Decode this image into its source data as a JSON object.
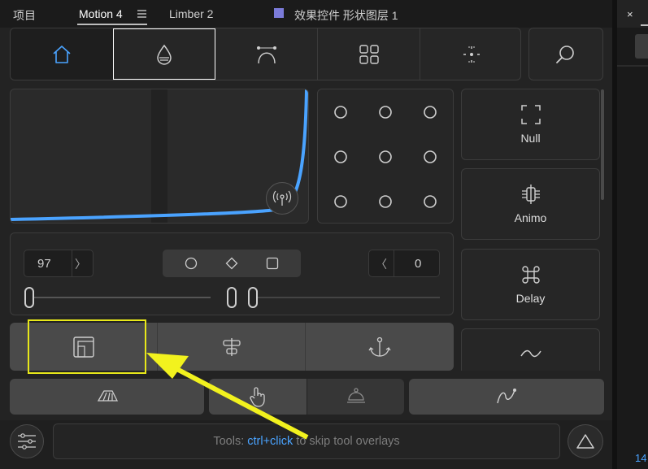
{
  "tabs": [
    {
      "label": "项目"
    },
    {
      "label": "Motion 4"
    },
    {
      "label": "Limber 2"
    }
  ],
  "panel_title": "效果控件 形状图层 1",
  "right_panel": {
    "close_glyph": "×",
    "partial_number": "14"
  },
  "colors": {
    "accent": "#4aa3ff",
    "highlight_box": "#e8e81a",
    "arrow": "#f2f21e",
    "title_swatch": "#7b7bd9"
  },
  "toolbar": {
    "icons": [
      "home-icon",
      "drop-icon",
      "bezier-curve-icon",
      "grid-four-icon",
      "anchor-dots-icon",
      "search-icon"
    ]
  },
  "tools_right": [
    {
      "label": "Null",
      "icon": "null-frame-icon"
    },
    {
      "label": "Animo",
      "icon": "animo-icon"
    },
    {
      "label": "Delay",
      "icon": "command-icon"
    },
    {
      "label": "",
      "icon": "wave-icon"
    }
  ],
  "ease": {
    "left_value": "97",
    "right_value": "0",
    "left_chevron": "〉",
    "right_chevron": "〈"
  },
  "footer": {
    "tip_prefix": "Tools: ",
    "tip_shortcut": "ctrl+click",
    "tip_suffix": " to skip tool overlays"
  }
}
